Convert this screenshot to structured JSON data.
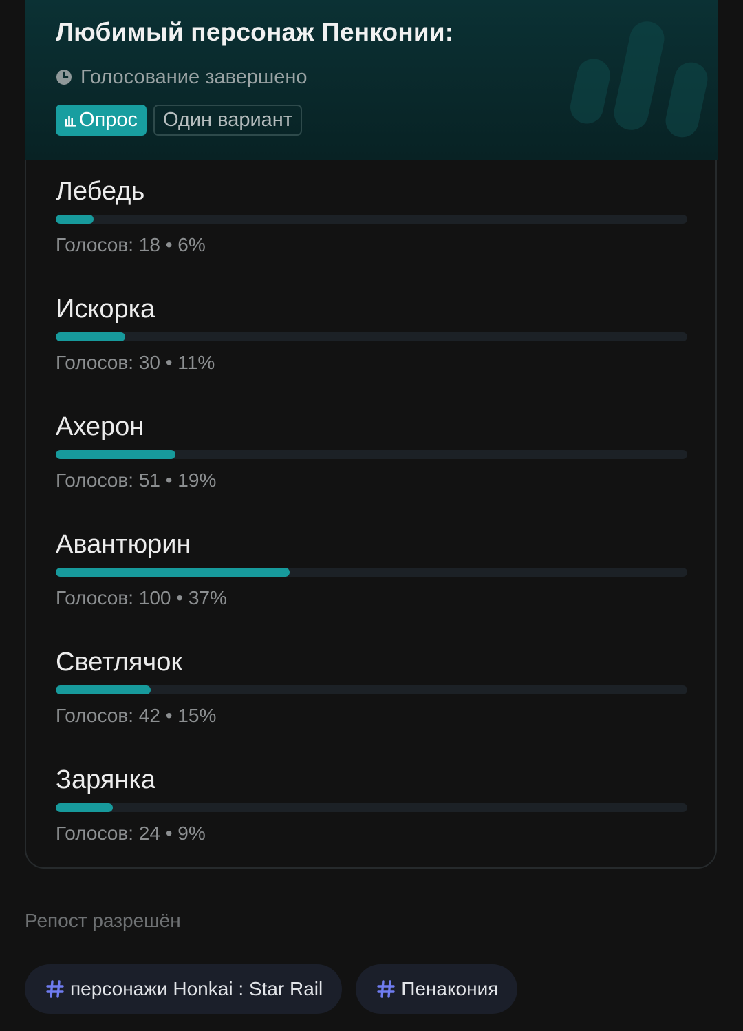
{
  "poll": {
    "title": "Любимый персонаж Пенконии:",
    "status": "Голосование завершено",
    "badge_poll": "Опрос",
    "badge_type": "Один вариант",
    "accent_color": "#189ea0",
    "options": [
      {
        "label": "Лебедь",
        "votes_text": "Голосов: 18 • 6%",
        "percent": 6
      },
      {
        "label": "Искорка",
        "votes_text": "Голосов: 30 • 11%",
        "percent": 11
      },
      {
        "label": "Ахерон",
        "votes_text": "Голосов: 51 • 19%",
        "percent": 19
      },
      {
        "label": "Авантюрин",
        "votes_text": "Голосов: 100 • 37%",
        "percent": 37
      },
      {
        "label": "Светлячок",
        "votes_text": "Голосов: 42 • 15%",
        "percent": 15
      },
      {
        "label": "Зарянка",
        "votes_text": "Голосов: 24 • 9%",
        "percent": 9
      }
    ]
  },
  "footer": {
    "repost_text": "Репост разрешён",
    "tags": [
      {
        "label": "персонажи Honkai : Star Rail",
        "icon": "hash-icon"
      },
      {
        "label": "Пенакония",
        "icon": "hash-icon"
      }
    ],
    "tag_icon_color": "#6f7cf0"
  }
}
